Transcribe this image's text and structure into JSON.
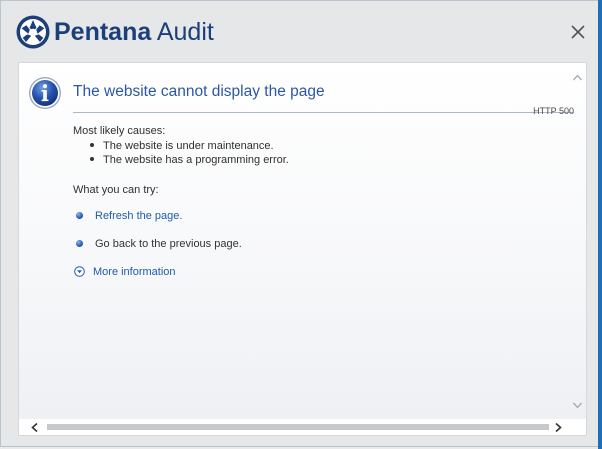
{
  "app": {
    "brand_bold": "Pentana",
    "brand_regular": " Audit",
    "logo_icon": "pentana-logo-icon",
    "brand_color": "#1d3f79"
  },
  "window": {
    "close_icon": "close-icon"
  },
  "error_page": {
    "icon": "info-icon",
    "title": "The website cannot display the page",
    "code": "HTTP 500",
    "causes_heading": "Most likely causes:",
    "causes": [
      "The website is under maintenance.",
      "The website has a programming error."
    ],
    "try_heading": "What you can try:",
    "actions": [
      {
        "label": "Refresh the page.",
        "link": true
      },
      {
        "label": "Go back to the previous page.",
        "link": false
      }
    ],
    "more_info": "More information",
    "link_color": "#1f5ca8",
    "title_color": "#2c57a6"
  },
  "scrollbars": {
    "up_icon": "scroll-up-icon",
    "down_icon": "scroll-down-icon",
    "left_icon": "scroll-left-icon",
    "right_icon": "scroll-right-icon"
  }
}
